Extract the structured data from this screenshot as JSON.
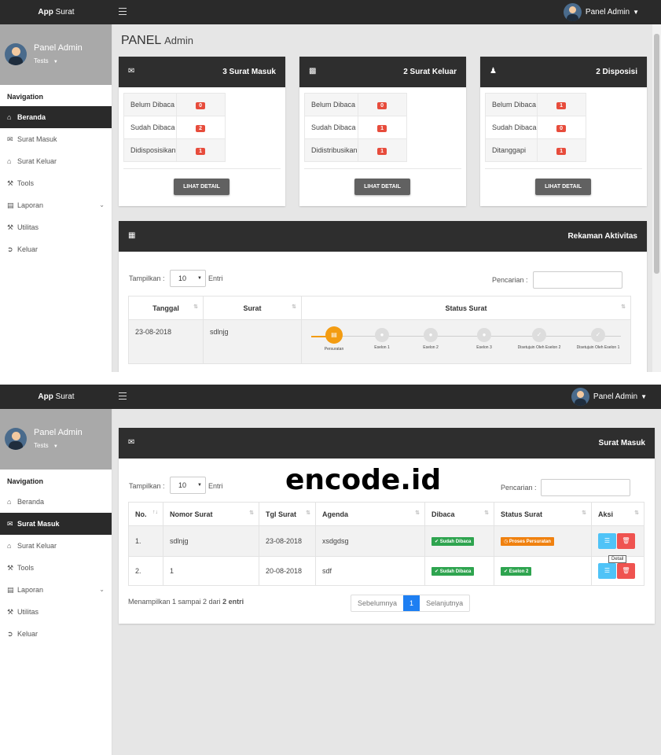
{
  "app": {
    "brand_bold": "App",
    "brand_rest": "Surat",
    "user": "Panel Admin"
  },
  "sidebar": {
    "name": "Panel Admin",
    "role": "Tests",
    "nav_title": "Navigation",
    "items": [
      {
        "label": "Beranda",
        "icon": "home-icon"
      },
      {
        "label": "Surat Masuk",
        "icon": "envelope-icon"
      },
      {
        "label": "Surat Keluar",
        "icon": "outbox-icon"
      },
      {
        "label": "Tools",
        "icon": "wrench-icon"
      },
      {
        "label": "Laporan",
        "icon": "document-icon"
      },
      {
        "label": "Utilitas",
        "icon": "wrench-icon"
      },
      {
        "label": "Keluar",
        "icon": "logout-icon"
      }
    ]
  },
  "dashboard": {
    "title_main": "PANEL",
    "title_sub": "Admin",
    "cards": [
      {
        "title": "3 Surat Masuk",
        "icon": "envelope-icon",
        "rows": [
          {
            "label": "Belum Dibaca",
            "value": "0"
          },
          {
            "label": "Sudah Dibaca",
            "value": "2"
          },
          {
            "label": "Didisposisikan",
            "value": "1"
          }
        ],
        "button": "LIHAT DETAIL"
      },
      {
        "title": "2 Surat Keluar",
        "icon": "outbox-icon",
        "rows": [
          {
            "label": "Belum Dibaca",
            "value": "0"
          },
          {
            "label": "Sudah Dibaca",
            "value": "1"
          },
          {
            "label": "Didistribusikan",
            "value": "1"
          }
        ],
        "button": "LIHAT DETAIL"
      },
      {
        "title": "2 Disposisi",
        "icon": "users-icon",
        "rows": [
          {
            "label": "Belum Dibaca",
            "value": "1"
          },
          {
            "label": "Sudah Dibaca",
            "value": "0"
          },
          {
            "label": "Ditanggapi",
            "value": "1"
          }
        ],
        "button": "LIHAT DETAIL"
      }
    ],
    "activity": {
      "title": "Rekaman Aktivitas",
      "show_label": "Tampilkan :",
      "show_value": "10",
      "entries_label": "Entri",
      "search_label": "Pencarian :",
      "columns": [
        "Tanggal",
        "Surat",
        "Status Surat"
      ],
      "row": {
        "date": "23-08-2018",
        "letter": "sdlnjg"
      },
      "steps": [
        "Persuratan",
        "Eselon 1",
        "Eselon 2",
        "Eselon 3",
        "Disetujuin Oleh Eselon 2",
        "Disetujuin Oleh Eselon 1"
      ]
    }
  },
  "inbox": {
    "title": "Surat Masuk",
    "watermark": "encode.id",
    "show_label": "Tampilkan :",
    "show_value": "10",
    "entries_label": "Entri",
    "search_label": "Pencarian :",
    "columns": [
      "No.",
      "Nomor Surat",
      "Tgl Surat",
      "Agenda",
      "Dibaca",
      "Status Surat",
      "Aksi"
    ],
    "rows": [
      {
        "no": "1.",
        "nomor": "sdlnjg",
        "tgl": "23-08-2018",
        "agenda": "xsdgdsg",
        "dibaca": "Sudah Dibaca",
        "status": "Proses Persuratan",
        "status_color": "#f0810f"
      },
      {
        "no": "2.",
        "nomor": "1",
        "tgl": "20-08-2018",
        "agenda": "sdf",
        "dibaca": "Sudah Dibaca",
        "status": "Eselon 2",
        "status_color": "#2ea44f"
      }
    ],
    "tooltip": "Detail",
    "info_prefix": "Menampilkan 1 sampai 2 dari",
    "info_bold": "2 entri",
    "pager": {
      "prev": "Sebelumnya",
      "current": "1",
      "next": "Selanjutnya"
    }
  }
}
